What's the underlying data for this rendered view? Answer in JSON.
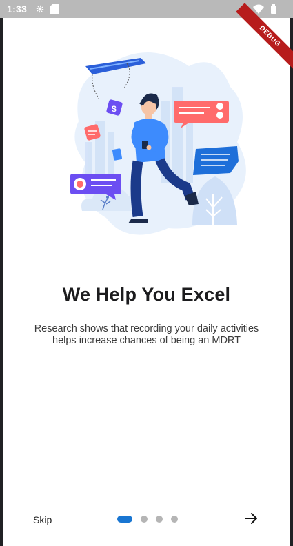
{
  "status_bar": {
    "time": "1:33",
    "icons": [
      "settings-icon",
      "sd-card-icon",
      "wifi-icon",
      "battery-icon"
    ]
  },
  "debug_banner": {
    "label": "DEBUG"
  },
  "onboarding": {
    "title": "We Help You Excel",
    "subtitle_line1": "Research shows that recording your daily activities",
    "subtitle_line2": "helps increase chances of being an MDRT"
  },
  "navigation": {
    "skip_label": "Skip",
    "current_page": 1,
    "total_pages": 4,
    "next_icon": "arrow-right-icon"
  },
  "colors": {
    "accent": "#1976d2",
    "inactive_dot": "#b5b5b5",
    "illustration_blue": "#3d8bfd",
    "illustration_red": "#ff6b6b",
    "illustration_purple": "#6c4ef2"
  }
}
